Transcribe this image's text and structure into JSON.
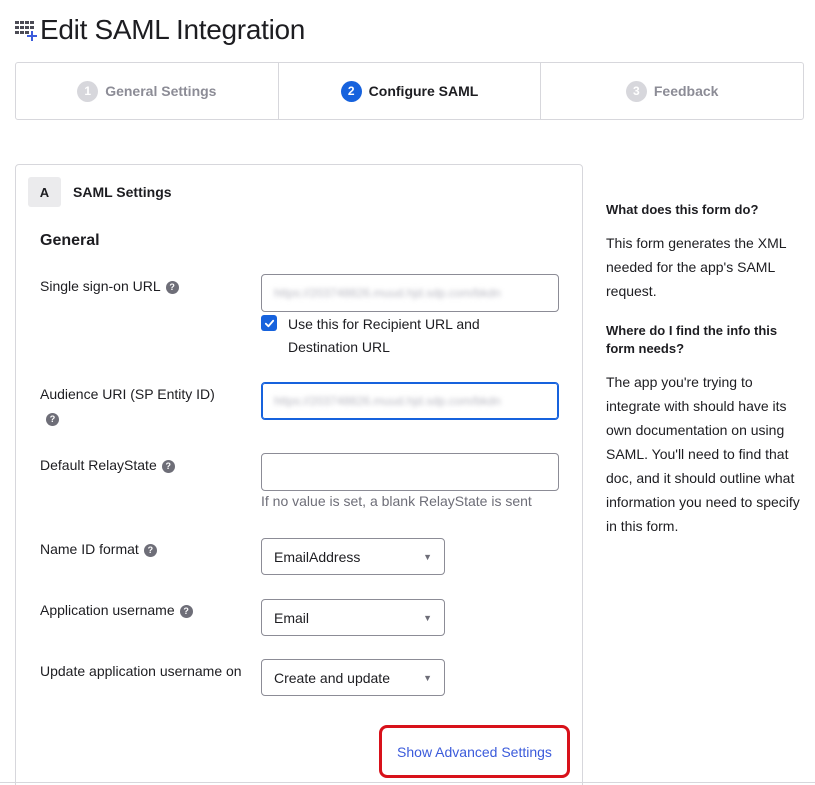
{
  "page": {
    "title": "Edit SAML Integration",
    "icon": "grid-plus-icon"
  },
  "steps": [
    {
      "number": "1",
      "label": "General Settings",
      "state": "inactive"
    },
    {
      "number": "2",
      "label": "Configure SAML",
      "state": "active"
    },
    {
      "number": "3",
      "label": "Feedback",
      "state": "inactive"
    }
  ],
  "card": {
    "badge": "A",
    "title": "SAML Settings",
    "section_title": "General"
  },
  "fields": {
    "sso_url": {
      "label": "Single sign-on URL",
      "value": "https://203748826.muud.hjd.sdp.com/bkdn",
      "checkbox_label": "Use this for Recipient URL and Destination URL",
      "checked": true
    },
    "audience_uri": {
      "label": "Audience URI (SP Entity ID)",
      "value": "https://203748826.muud.hjd.sdp.com/bkdn"
    },
    "relay_state": {
      "label": "Default RelayState",
      "value": "",
      "hint": "If no value is set, a blank RelayState is sent"
    },
    "name_id_format": {
      "label": "Name ID format",
      "value": "EmailAddress"
    },
    "app_username": {
      "label": "Application username",
      "value": "Email"
    },
    "update_username": {
      "label": "Update application username on",
      "value": "Create and update"
    }
  },
  "advanced_link": "Show Advanced Settings",
  "aside": {
    "q1": "What does this form do?",
    "a1": "This form generates the XML needed for the app's SAML request.",
    "q2": "Where do I find the info this form needs?",
    "a2": "The app you're trying to integrate with should have its own documentation on using SAML. You'll need to find that doc, and it should outline what information you need to specify in this form."
  },
  "colors": {
    "accent": "#1662dd",
    "link": "#3b5bdb",
    "highlight": "#d8111a",
    "border": "#d7d7dc"
  }
}
